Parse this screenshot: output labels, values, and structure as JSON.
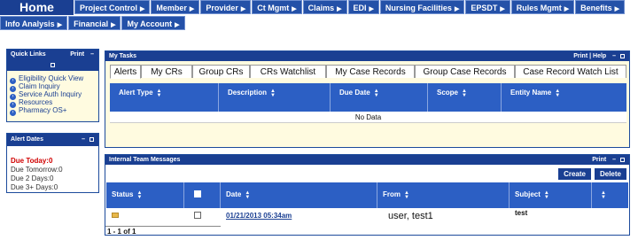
{
  "nav": {
    "home": "Home",
    "row1": [
      "Project Control",
      "Member",
      "Provider",
      "Ct Mgmt",
      "Claims",
      "EDI",
      "Nursing Facilities",
      "EPSDT",
      "Rules Mgmt",
      "Benefits"
    ],
    "row2": [
      "Info Analysis",
      "Financial",
      "My Account"
    ]
  },
  "quick_links": {
    "title": "Quick Links",
    "print": "Print",
    "collapse": "–",
    "items": [
      "Eligibility Quick View",
      "Claim Inquiry",
      "Service Auth Inquiry",
      "Resources",
      "Pharmacy OS+"
    ]
  },
  "alert_dates": {
    "title": "Alert Dates",
    "collapse": "–",
    "today_label": "Due Today:",
    "today_value": "0",
    "rows": [
      {
        "label": "Due Tomorrow:",
        "value": "0"
      },
      {
        "label": "Due 2 Days:",
        "value": "0"
      },
      {
        "label": "Due 3+ Days:",
        "value": "0"
      }
    ]
  },
  "my_tasks": {
    "title": "My Tasks",
    "actions": "Print | Help",
    "collapse": "–",
    "tabs": [
      "Alerts",
      "My CRs",
      "Group CRs",
      "CRs Watchlist",
      "My Case Records",
      "Group Case Records",
      "Case Record Watch List"
    ],
    "active_tab": "Alerts",
    "columns": [
      "Alert Type",
      "Description",
      "Due Date",
      "Scope",
      "Entity Name"
    ],
    "empty_text": "No Data"
  },
  "messages": {
    "title": "Internal Team Messages",
    "print": "Print",
    "collapse": "–",
    "create": "Create",
    "delete": "Delete",
    "columns": {
      "status": "Status",
      "date": "Date",
      "from": "From",
      "subject": "Subject"
    },
    "rows": [
      {
        "date": "01/21/2013 05:34am",
        "from": "user, test1",
        "subject": "test"
      }
    ],
    "pager": "1 - 1 of 1"
  },
  "colors": {
    "header_dark": "#1a3f92",
    "table_header": "#2c5fc4",
    "panel_bg": "#fffbe0",
    "alert_red": "#d00000"
  }
}
